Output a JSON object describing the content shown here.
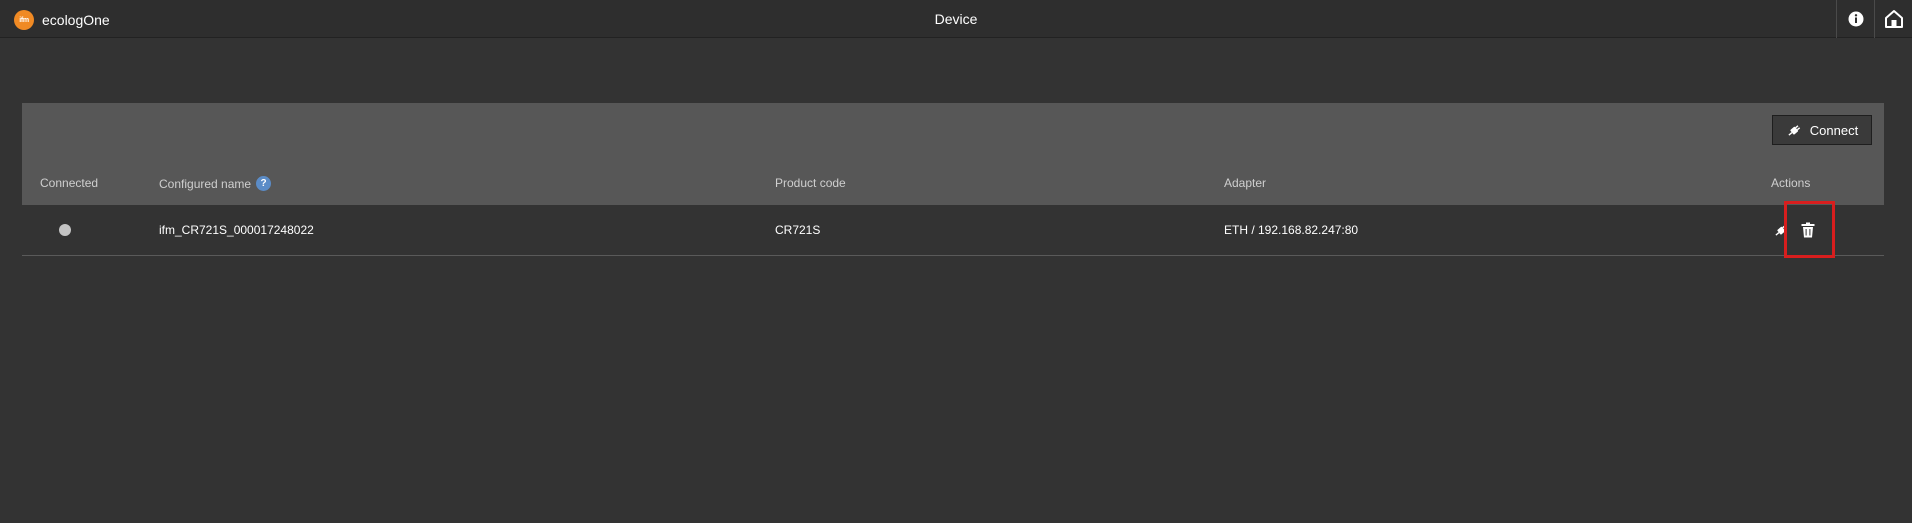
{
  "app": {
    "logo_text": "ifm",
    "title": "ecologOne"
  },
  "header": {
    "page_title": "Device",
    "info_icon": "info-icon",
    "home_icon": "home-icon"
  },
  "toolbar": {
    "connect_label": "Connect",
    "connect_icon": "plug-icon"
  },
  "table": {
    "columns": {
      "connected": "Connected",
      "configured_name": "Configured name",
      "configured_name_help": "?",
      "product_code": "Product code",
      "adapter": "Adapter",
      "actions": "Actions"
    },
    "rows": [
      {
        "connected": false,
        "configured_name": "ifm_CR721S_000017248022",
        "product_code": "CR721S",
        "adapter": "ETH / 192.168.82.247:80",
        "actions": [
          "plug-icon",
          "trash-icon"
        ]
      }
    ]
  },
  "colors": {
    "background": "#333333",
    "header_band": "#575757",
    "brand_orange": "#f08a24",
    "help_blue": "#5b8cc7",
    "highlight_red": "#d81e1e",
    "status_disconnected": "#c4c4c4"
  }
}
